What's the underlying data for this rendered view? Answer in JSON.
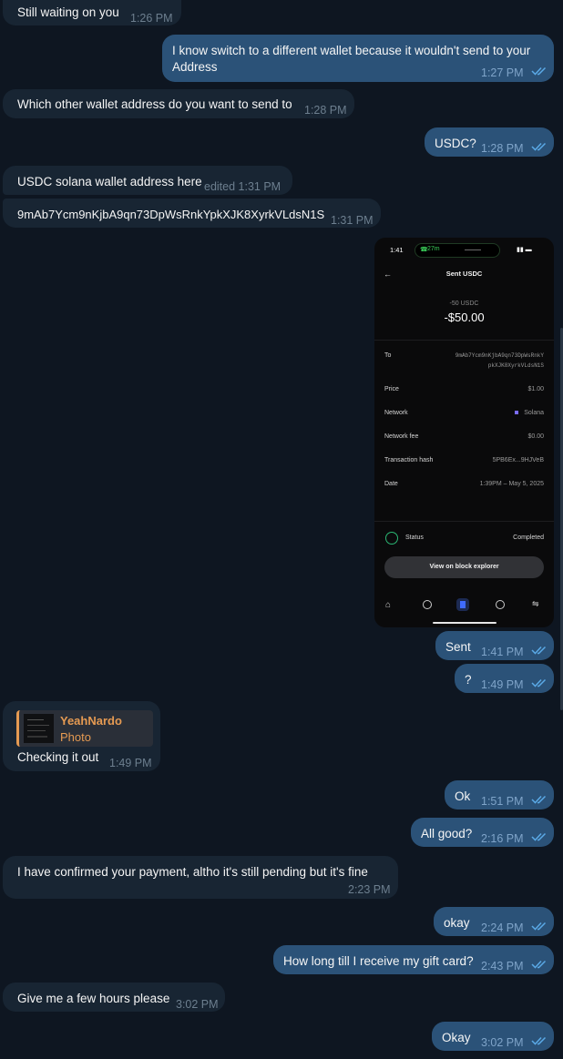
{
  "messages": [
    {
      "text": "Still waiting on you",
      "time": "1:26 PM"
    },
    {
      "text": "I know switch to a different wallet because it wouldn't send to your",
      "text2": "Address",
      "time": "1:27 PM"
    },
    {
      "text": "Which other wallet address do you want to send to",
      "time": "1:28 PM"
    },
    {
      "text": "USDC?",
      "time": "1:28 PM"
    },
    {
      "text": "USDC solana wallet address here",
      "time": "edited 1:31 PM"
    },
    {
      "text": "9mAb7Ycm9nKjbA9qn73DpWsRnkYpkXJK8XyrkVLdsN1S",
      "time": "1:31 PM"
    },
    {
      "text": "Sent",
      "time": "1:41 PM"
    },
    {
      "text": "?",
      "time": "1:49 PM"
    },
    {
      "reply_name": "YeahNardo",
      "reply_type": "Photo",
      "text": "Checking it out",
      "time": "1:49 PM"
    },
    {
      "text": "Ok",
      "time": "1:51 PM"
    },
    {
      "text": "All good?",
      "time": "2:16 PM"
    },
    {
      "text": "I have confirmed your payment, altho it's still pending but it's fine",
      "time": "2:23 PM"
    },
    {
      "text": "okay",
      "time": "2:24 PM"
    },
    {
      "text": "How long till I receive my gift card?",
      "time": "2:43 PM"
    },
    {
      "text": "Give me a few hours please",
      "time": "3:02 PM"
    },
    {
      "text": "Okay",
      "time": "3:02 PM"
    }
  ],
  "photo": {
    "status_time": "1:41",
    "call_pill": "27m",
    "title": "Sent USDC",
    "amount_small": "-50 USDC",
    "amount_big": "-$50.00",
    "rows": [
      {
        "label": "To",
        "value": "9mAb7Ycm9nKjbA9qn73DpWsRnkY",
        "value2": "pkXJK8XyrkVLdsN1S"
      },
      {
        "label": "Price",
        "value": "$1.00"
      },
      {
        "label": "Network",
        "value": "Solana"
      },
      {
        "label": "Network fee",
        "value": "$0.00"
      },
      {
        "label": "Transaction hash",
        "value": "5PB6Ex...9HJVeB"
      },
      {
        "label": "Date",
        "value": "1:39PM – May 5, 2025"
      }
    ],
    "status_label": "Status",
    "status_value": "Completed",
    "explorer_button": "View on block explorer"
  },
  "colors": {
    "background": "#0e1621",
    "incoming": "#182533",
    "outgoing": "#2b5278",
    "accent": "#e59a52",
    "check": "#5aa9e6"
  }
}
